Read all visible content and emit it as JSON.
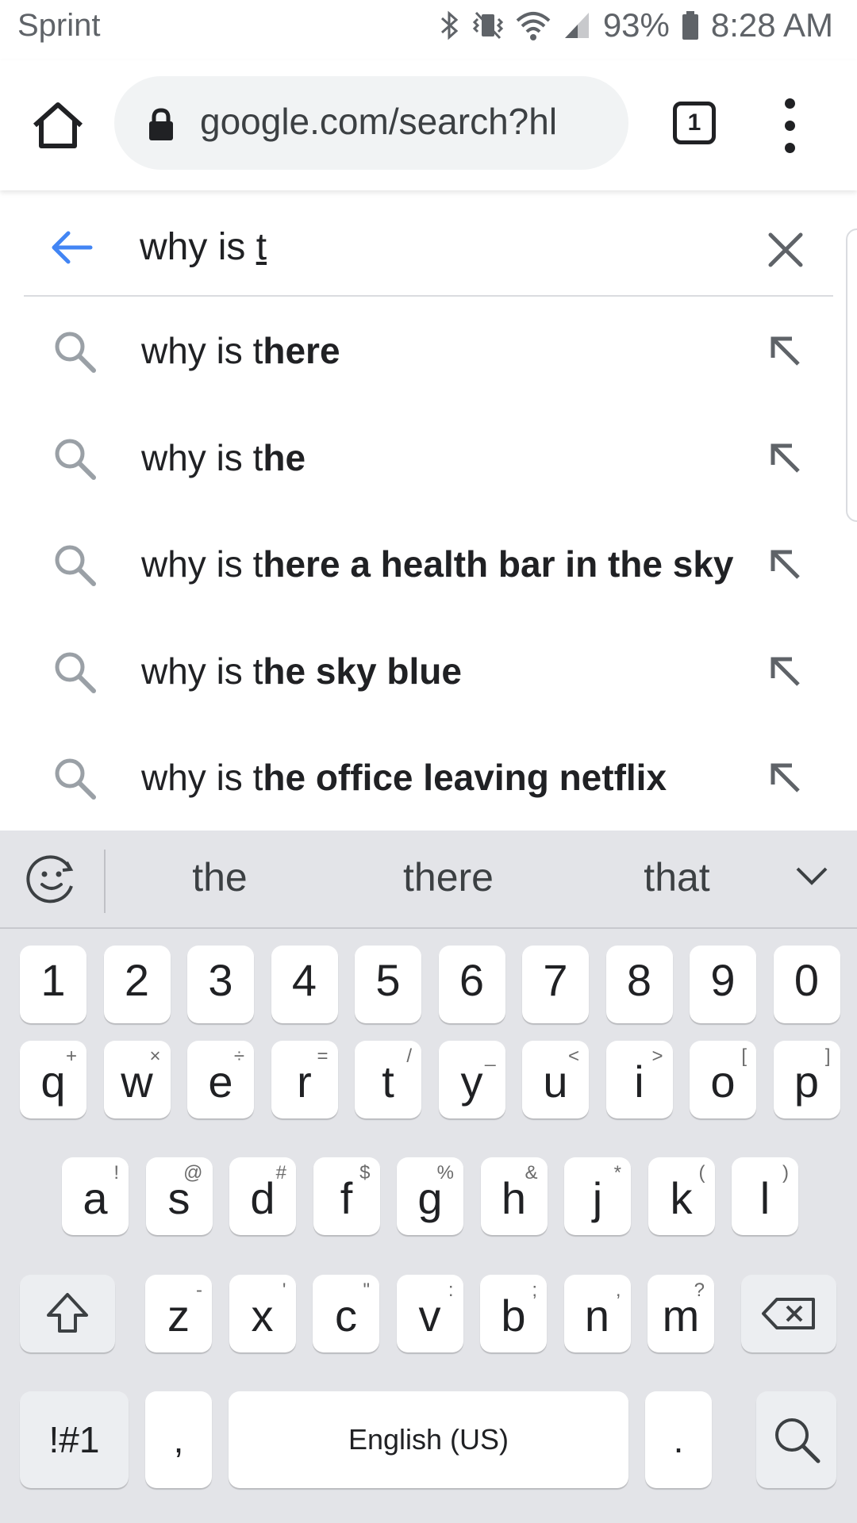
{
  "status_bar": {
    "carrier": "Sprint",
    "battery": "93%",
    "time": "8:28 AM",
    "icons": [
      "bluetooth-icon",
      "vibrate-icon",
      "wifi-icon",
      "signal-icon",
      "battery-icon"
    ]
  },
  "toolbar": {
    "url": "google.com/search?hl",
    "tab_count": "1"
  },
  "search": {
    "query_prefix": "why is ",
    "query_cursor_char": "t"
  },
  "suggestions": [
    {
      "typed": "why is t",
      "completion": "here"
    },
    {
      "typed": "why is t",
      "completion": "he"
    },
    {
      "typed": "why is t",
      "completion": "here a health bar in the sky"
    },
    {
      "typed": "why is t",
      "completion": "he sky blue"
    },
    {
      "typed": "why is t",
      "completion": "he office leaving netflix"
    }
  ],
  "keyboard": {
    "predictions": [
      "the",
      "there",
      "that"
    ],
    "row_numbers": [
      "1",
      "2",
      "3",
      "4",
      "5",
      "6",
      "7",
      "8",
      "9",
      "0"
    ],
    "row_q": [
      {
        "k": "q",
        "h": "+"
      },
      {
        "k": "w",
        "h": "×"
      },
      {
        "k": "e",
        "h": "÷"
      },
      {
        "k": "r",
        "h": "="
      },
      {
        "k": "t",
        "h": "/"
      },
      {
        "k": "y",
        "h": "_"
      },
      {
        "k": "u",
        "h": "<"
      },
      {
        "k": "i",
        "h": ">"
      },
      {
        "k": "o",
        "h": "["
      },
      {
        "k": "p",
        "h": "]"
      }
    ],
    "row_a": [
      {
        "k": "a",
        "h": "!"
      },
      {
        "k": "s",
        "h": "@"
      },
      {
        "k": "d",
        "h": "#"
      },
      {
        "k": "f",
        "h": "$"
      },
      {
        "k": "g",
        "h": "%"
      },
      {
        "k": "h",
        "h": "&"
      },
      {
        "k": "j",
        "h": "*"
      },
      {
        "k": "k",
        "h": "("
      },
      {
        "k": "l",
        "h": ")"
      }
    ],
    "row_z": [
      {
        "k": "z",
        "h": "-"
      },
      {
        "k": "x",
        "h": "'"
      },
      {
        "k": "c",
        "h": "\""
      },
      {
        "k": "v",
        "h": ":"
      },
      {
        "k": "b",
        "h": ";"
      },
      {
        "k": "n",
        "h": ","
      },
      {
        "k": "m",
        "h": "?"
      }
    ],
    "symbols_label": "!#1",
    "comma": ",",
    "space_label": "English (US)",
    "period": "."
  }
}
